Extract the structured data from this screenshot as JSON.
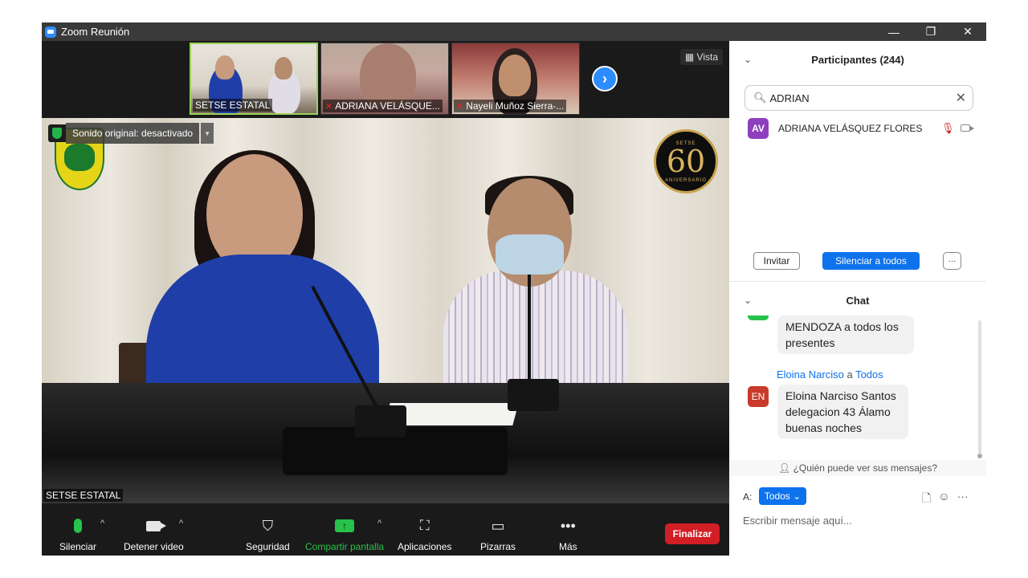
{
  "window": {
    "title": "Zoom Reunión",
    "controls": {
      "minimize": "—",
      "restore": "❐",
      "close": "✕"
    }
  },
  "thumbnails": [
    {
      "name": "SETSE ESTATAL",
      "muted": false,
      "active": true
    },
    {
      "name": "ADRIANA VELÁSQUE...",
      "muted": true,
      "active": false
    },
    {
      "name": "Nayeli Muñoz Sierra-...",
      "muted": true,
      "active": false
    }
  ],
  "view_button": {
    "icon": "grid-icon",
    "label": "Vista"
  },
  "main_video": {
    "speaker_name": "SETSE ESTATAL",
    "sound_notice": "Sonido original: desactivado",
    "anniversary_number": "60",
    "anniversary_top": "SETSE",
    "anniversary_text": "ANIVERSARIO"
  },
  "toolbar": {
    "mute": {
      "label": "Silenciar",
      "icon": "microphone-icon"
    },
    "video": {
      "label": "Detener video",
      "icon": "camera-icon"
    },
    "security": {
      "label": "Seguridad",
      "icon": "shield-icon"
    },
    "share": {
      "label": "Compartir pantalla",
      "icon": "share-arrow-icon"
    },
    "apps": {
      "label": "Aplicaciones",
      "icon": "apps-icon"
    },
    "whiteboard": {
      "label": "Pizarras",
      "icon": "whiteboard-icon"
    },
    "more": {
      "label": "Más",
      "icon": "more-dots-icon"
    },
    "end": {
      "label": "Finalizar"
    }
  },
  "participants": {
    "title": "Participantes (244)",
    "search_value": "ADRIAN",
    "results": [
      {
        "initials": "AV",
        "name": "ADRIANA VELÁSQUEZ FLORES",
        "avatar_color": "#8e3fbf",
        "muted": true,
        "video_off": true
      }
    ],
    "invite_label": "Invitar",
    "mute_all_label": "Silenciar a todos",
    "more_label": "···"
  },
  "chat": {
    "title": "Chat",
    "messages": [
      {
        "sender": "",
        "to": "",
        "text_lines": [
          "MENDOZA a todos los",
          "presentes"
        ]
      },
      {
        "sender": "Eloina Narciso",
        "to_word": "a",
        "to": "Todos",
        "initials": "EN",
        "avatar_color": "#c83a2a",
        "text_lines": [
          "Eloina Narciso Santos",
          "delegacion 43 Álamo",
          "buenas noches"
        ]
      }
    ],
    "visibility_note": "¿Quién puede ver sus mensajes?",
    "to_label": "A:",
    "recipient": "Todos",
    "input_placeholder": "Escribir mensaje aquí...",
    "icons": [
      "file-icon",
      "emoji-icon",
      "more-dots-icon"
    ]
  },
  "colors": {
    "accent_blue": "#0e72ed",
    "zoom_blue": "#2d8cff",
    "end_red": "#d21e25",
    "active_green": "#26c24a"
  }
}
